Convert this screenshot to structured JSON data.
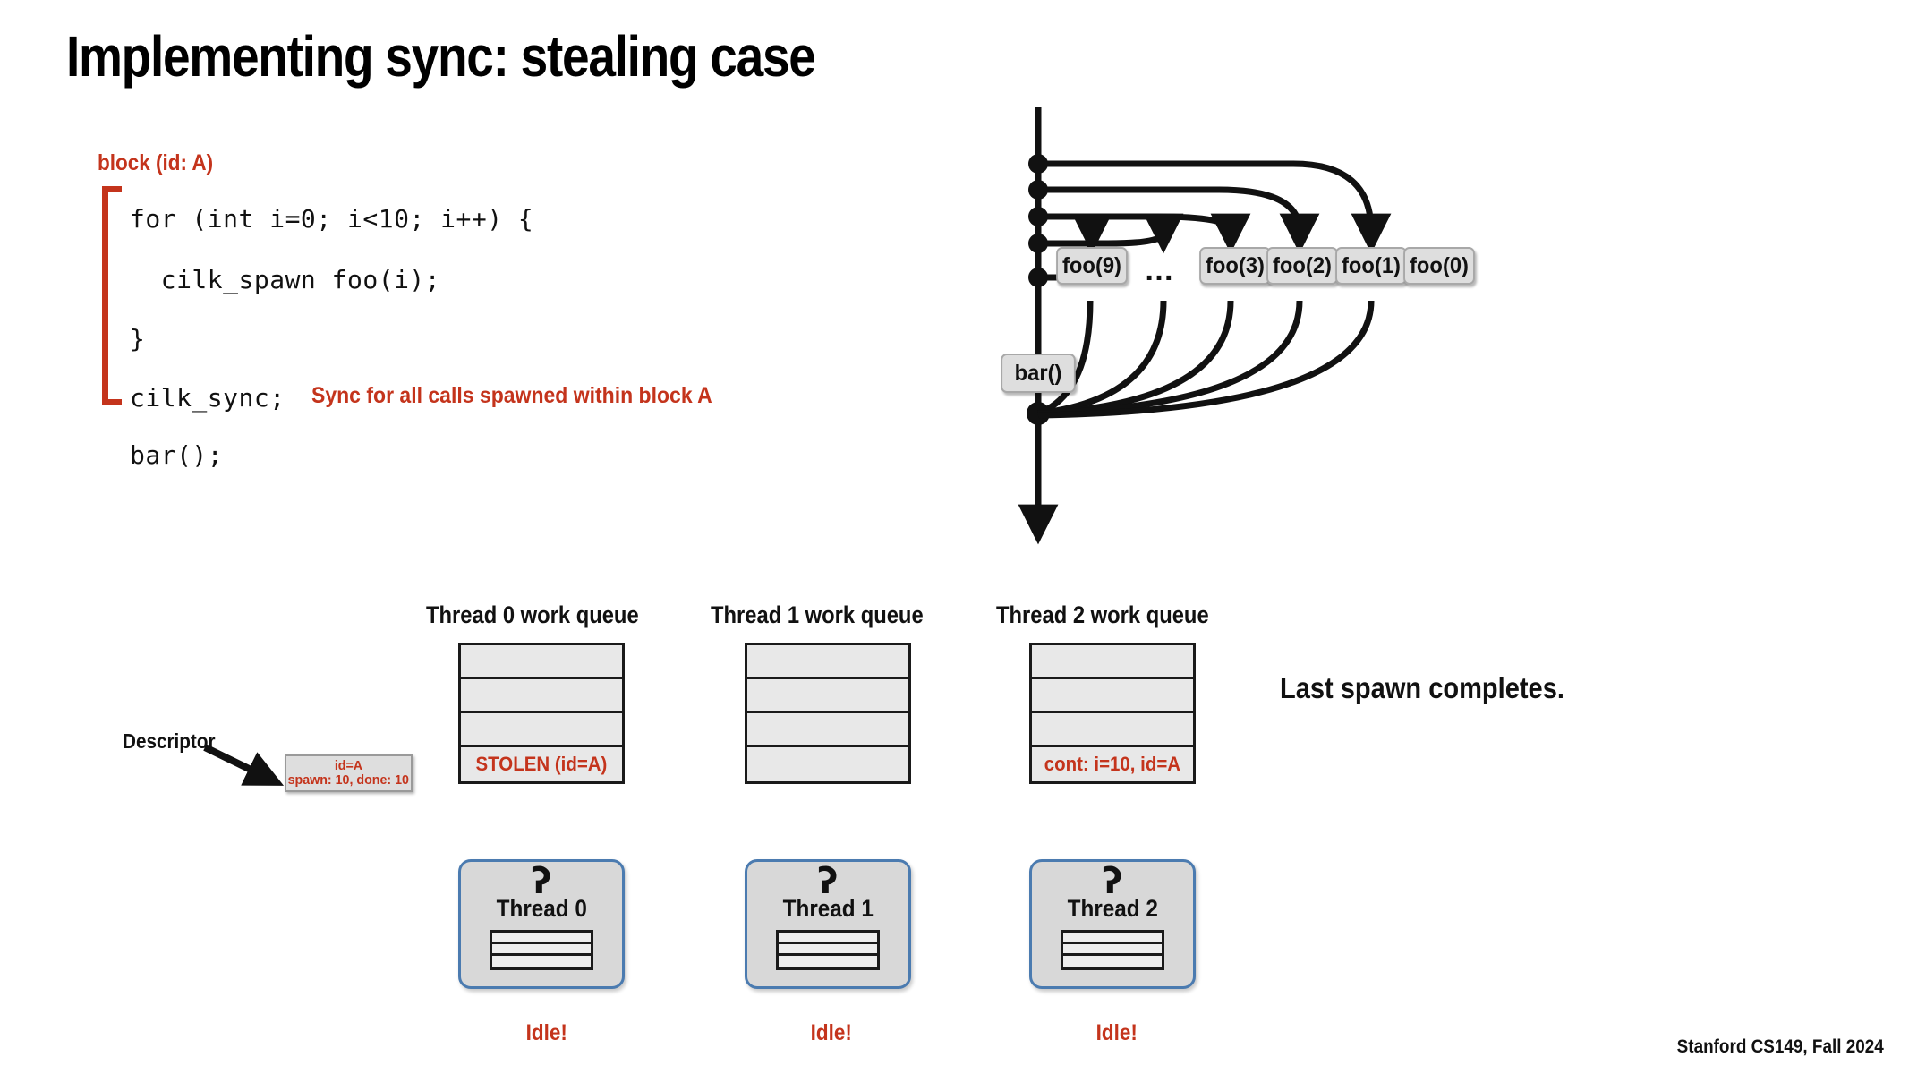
{
  "slide": {
    "title": "Implementing sync: stealing case",
    "footer": "Stanford CS149, Fall 2024",
    "annotation": "Last spawn completes.",
    "accent_red": "#C4341C",
    "thread_border_blue": "#4B7BB0"
  },
  "code": {
    "block_label": "block (id: A)",
    "lines": [
      "for (int i=0; i<10; i++) {",
      "  cilk_spawn foo(i);",
      "}",
      "cilk_sync;",
      "bar();"
    ],
    "sync_note": "Sync for all calls spawned within block A"
  },
  "graph": {
    "spawn_nodes": [
      {
        "label": "foo(9)"
      },
      {
        "label": "foo(3)"
      },
      {
        "label": "foo(2)"
      },
      {
        "label": "foo(1)"
      },
      {
        "label": "foo(0)"
      }
    ],
    "ellipsis": "…",
    "continuation_node": "bar()"
  },
  "queues": [
    {
      "title": "Thread 0 work queue",
      "cells": [
        "",
        "",
        "",
        "STOLEN (id=A)"
      ]
    },
    {
      "title": "Thread 1 work queue",
      "cells": [
        "",
        "",
        "",
        ""
      ]
    },
    {
      "title": "Thread 2 work queue",
      "cells": [
        "",
        "",
        "",
        "cont: i=10, id=A"
      ]
    }
  ],
  "descriptor": {
    "label": "Descriptor",
    "id_line": "id=A",
    "counts_line": "spawn: 10, done: 10"
  },
  "threads": [
    {
      "name": "Thread 0",
      "glyph": "ʔ",
      "status": "Idle!"
    },
    {
      "name": "Thread 1",
      "glyph": "ʔ",
      "status": "Idle!"
    },
    {
      "name": "Thread 2",
      "glyph": "ʔ",
      "status": "Idle!"
    }
  ]
}
